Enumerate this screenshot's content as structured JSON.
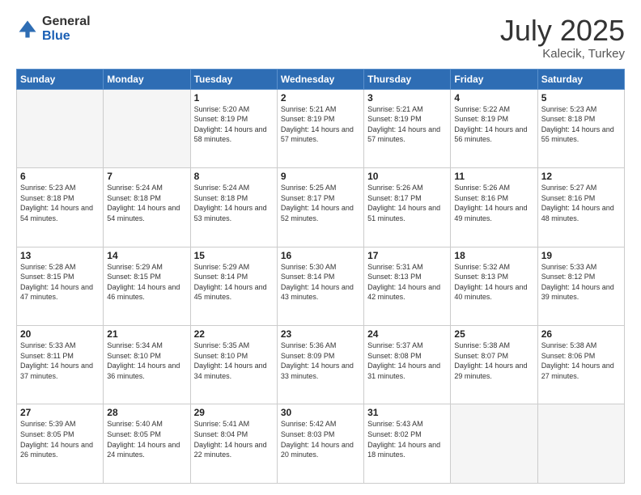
{
  "logo": {
    "general": "General",
    "blue": "Blue"
  },
  "header": {
    "month": "July 2025",
    "location": "Kalecik, Turkey"
  },
  "days": [
    "Sunday",
    "Monday",
    "Tuesday",
    "Wednesday",
    "Thursday",
    "Friday",
    "Saturday"
  ],
  "weeks": [
    [
      {
        "day": "",
        "empty": true
      },
      {
        "day": "",
        "empty": true
      },
      {
        "day": "1",
        "sunrise": "Sunrise: 5:20 AM",
        "sunset": "Sunset: 8:19 PM",
        "daylight": "Daylight: 14 hours and 58 minutes."
      },
      {
        "day": "2",
        "sunrise": "Sunrise: 5:21 AM",
        "sunset": "Sunset: 8:19 PM",
        "daylight": "Daylight: 14 hours and 57 minutes."
      },
      {
        "day": "3",
        "sunrise": "Sunrise: 5:21 AM",
        "sunset": "Sunset: 8:19 PM",
        "daylight": "Daylight: 14 hours and 57 minutes."
      },
      {
        "day": "4",
        "sunrise": "Sunrise: 5:22 AM",
        "sunset": "Sunset: 8:19 PM",
        "daylight": "Daylight: 14 hours and 56 minutes."
      },
      {
        "day": "5",
        "sunrise": "Sunrise: 5:23 AM",
        "sunset": "Sunset: 8:18 PM",
        "daylight": "Daylight: 14 hours and 55 minutes."
      }
    ],
    [
      {
        "day": "6",
        "sunrise": "Sunrise: 5:23 AM",
        "sunset": "Sunset: 8:18 PM",
        "daylight": "Daylight: 14 hours and 54 minutes."
      },
      {
        "day": "7",
        "sunrise": "Sunrise: 5:24 AM",
        "sunset": "Sunset: 8:18 PM",
        "daylight": "Daylight: 14 hours and 54 minutes."
      },
      {
        "day": "8",
        "sunrise": "Sunrise: 5:24 AM",
        "sunset": "Sunset: 8:18 PM",
        "daylight": "Daylight: 14 hours and 53 minutes."
      },
      {
        "day": "9",
        "sunrise": "Sunrise: 5:25 AM",
        "sunset": "Sunset: 8:17 PM",
        "daylight": "Daylight: 14 hours and 52 minutes."
      },
      {
        "day": "10",
        "sunrise": "Sunrise: 5:26 AM",
        "sunset": "Sunset: 8:17 PM",
        "daylight": "Daylight: 14 hours and 51 minutes."
      },
      {
        "day": "11",
        "sunrise": "Sunrise: 5:26 AM",
        "sunset": "Sunset: 8:16 PM",
        "daylight": "Daylight: 14 hours and 49 minutes."
      },
      {
        "day": "12",
        "sunrise": "Sunrise: 5:27 AM",
        "sunset": "Sunset: 8:16 PM",
        "daylight": "Daylight: 14 hours and 48 minutes."
      }
    ],
    [
      {
        "day": "13",
        "sunrise": "Sunrise: 5:28 AM",
        "sunset": "Sunset: 8:15 PM",
        "daylight": "Daylight: 14 hours and 47 minutes."
      },
      {
        "day": "14",
        "sunrise": "Sunrise: 5:29 AM",
        "sunset": "Sunset: 8:15 PM",
        "daylight": "Daylight: 14 hours and 46 minutes."
      },
      {
        "day": "15",
        "sunrise": "Sunrise: 5:29 AM",
        "sunset": "Sunset: 8:14 PM",
        "daylight": "Daylight: 14 hours and 45 minutes."
      },
      {
        "day": "16",
        "sunrise": "Sunrise: 5:30 AM",
        "sunset": "Sunset: 8:14 PM",
        "daylight": "Daylight: 14 hours and 43 minutes."
      },
      {
        "day": "17",
        "sunrise": "Sunrise: 5:31 AM",
        "sunset": "Sunset: 8:13 PM",
        "daylight": "Daylight: 14 hours and 42 minutes."
      },
      {
        "day": "18",
        "sunrise": "Sunrise: 5:32 AM",
        "sunset": "Sunset: 8:13 PM",
        "daylight": "Daylight: 14 hours and 40 minutes."
      },
      {
        "day": "19",
        "sunrise": "Sunrise: 5:33 AM",
        "sunset": "Sunset: 8:12 PM",
        "daylight": "Daylight: 14 hours and 39 minutes."
      }
    ],
    [
      {
        "day": "20",
        "sunrise": "Sunrise: 5:33 AM",
        "sunset": "Sunset: 8:11 PM",
        "daylight": "Daylight: 14 hours and 37 minutes."
      },
      {
        "day": "21",
        "sunrise": "Sunrise: 5:34 AM",
        "sunset": "Sunset: 8:10 PM",
        "daylight": "Daylight: 14 hours and 36 minutes."
      },
      {
        "day": "22",
        "sunrise": "Sunrise: 5:35 AM",
        "sunset": "Sunset: 8:10 PM",
        "daylight": "Daylight: 14 hours and 34 minutes."
      },
      {
        "day": "23",
        "sunrise": "Sunrise: 5:36 AM",
        "sunset": "Sunset: 8:09 PM",
        "daylight": "Daylight: 14 hours and 33 minutes."
      },
      {
        "day": "24",
        "sunrise": "Sunrise: 5:37 AM",
        "sunset": "Sunset: 8:08 PM",
        "daylight": "Daylight: 14 hours and 31 minutes."
      },
      {
        "day": "25",
        "sunrise": "Sunrise: 5:38 AM",
        "sunset": "Sunset: 8:07 PM",
        "daylight": "Daylight: 14 hours and 29 minutes."
      },
      {
        "day": "26",
        "sunrise": "Sunrise: 5:38 AM",
        "sunset": "Sunset: 8:06 PM",
        "daylight": "Daylight: 14 hours and 27 minutes."
      }
    ],
    [
      {
        "day": "27",
        "sunrise": "Sunrise: 5:39 AM",
        "sunset": "Sunset: 8:05 PM",
        "daylight": "Daylight: 14 hours and 26 minutes."
      },
      {
        "day": "28",
        "sunrise": "Sunrise: 5:40 AM",
        "sunset": "Sunset: 8:05 PM",
        "daylight": "Daylight: 14 hours and 24 minutes."
      },
      {
        "day": "29",
        "sunrise": "Sunrise: 5:41 AM",
        "sunset": "Sunset: 8:04 PM",
        "daylight": "Daylight: 14 hours and 22 minutes."
      },
      {
        "day": "30",
        "sunrise": "Sunrise: 5:42 AM",
        "sunset": "Sunset: 8:03 PM",
        "daylight": "Daylight: 14 hours and 20 minutes."
      },
      {
        "day": "31",
        "sunrise": "Sunrise: 5:43 AM",
        "sunset": "Sunset: 8:02 PM",
        "daylight": "Daylight: 14 hours and 18 minutes."
      },
      {
        "day": "",
        "empty": true
      },
      {
        "day": "",
        "empty": true
      }
    ]
  ]
}
